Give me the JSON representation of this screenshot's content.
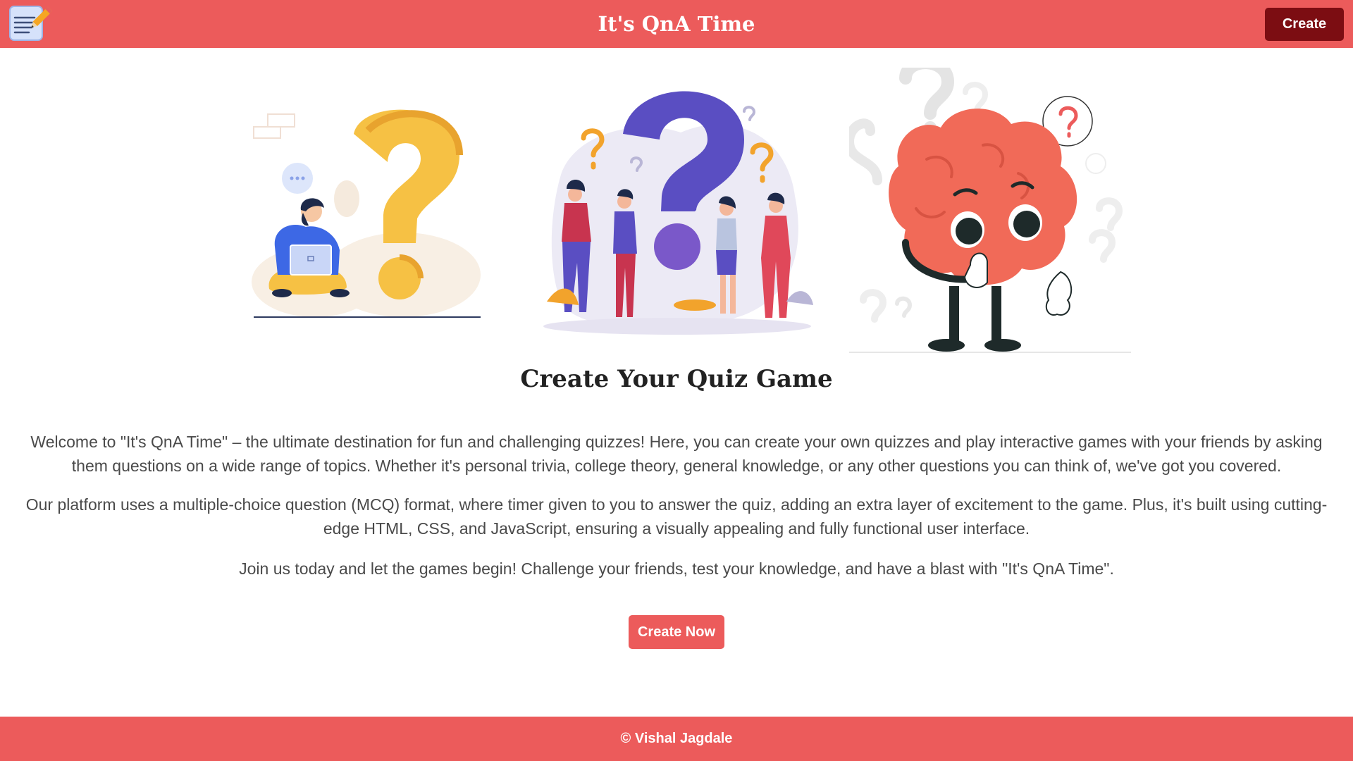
{
  "header": {
    "title": "It's QnA Time",
    "create_label": "Create",
    "logo_icon": "notepad-pencil-icon"
  },
  "main": {
    "illustrations": [
      "person-thinking-question-mark",
      "group-discussing-question-mark",
      "thinking-brain-character"
    ],
    "title": "Create Your Quiz Game",
    "paragraphs": [
      "Welcome to \"It's QnA Time\" – the ultimate destination for fun and challenging quizzes! Here, you can create your own quizzes and play interactive games with your friends by asking them questions on a wide range of topics. Whether it's personal trivia, college theory, general knowledge, or any other questions you can think of, we've got you covered.",
      "Our platform uses a multiple-choice question (MCQ) format, where timer given to you to answer the quiz, adding an extra layer of excitement to the game. Plus, it's built using cutting-edge HTML, CSS, and JavaScript, ensuring a visually appealing and fully functional user interface.",
      "Join us today and let the games begin! Challenge your friends, test your knowledge, and have a blast with \"It's QnA Time\"."
    ],
    "cta_label": "Create Now"
  },
  "footer": {
    "copyright": "© Vishal Jagdale"
  },
  "colors": {
    "brand": "#ec5b5b",
    "dark_button": "#7c0d12",
    "text": "#4a4a4a",
    "heading": "#222222"
  }
}
